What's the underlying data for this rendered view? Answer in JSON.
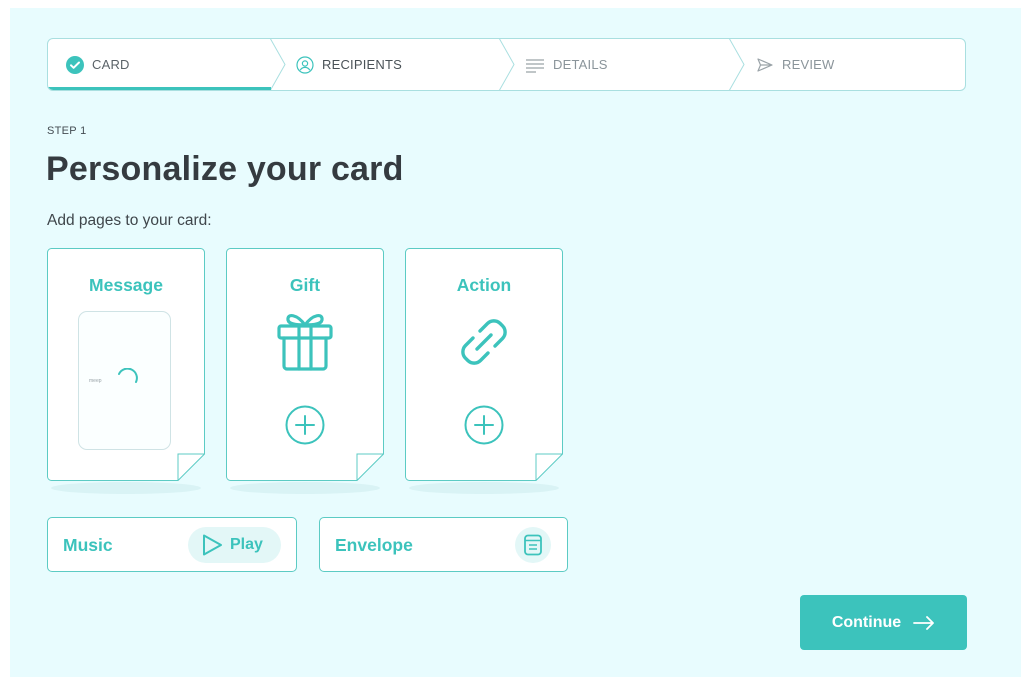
{
  "stepper": {
    "steps": [
      {
        "label": "CARD",
        "icon": "check-circle-icon",
        "state": "active"
      },
      {
        "label": "RECIPIENTS",
        "icon": "user-circle-icon",
        "state": "upcoming"
      },
      {
        "label": "DETAILS",
        "icon": "lines-icon",
        "state": "upcoming"
      },
      {
        "label": "REVIEW",
        "icon": "send-icon",
        "state": "upcoming"
      }
    ]
  },
  "step_eyebrow": "STEP 1",
  "title": "Personalize your card",
  "subtitle": "Add pages to your card:",
  "pages": [
    {
      "label": "Message",
      "preview_text": "meep",
      "icon": "loading-spinner-icon"
    },
    {
      "label": "Gift",
      "icon": "gift-icon"
    },
    {
      "label": "Action",
      "icon": "link-icon"
    }
  ],
  "options": {
    "music": {
      "label": "Music",
      "play_label": "Play"
    },
    "envelope": {
      "label": "Envelope",
      "icon": "envelope-icon"
    }
  },
  "continue_label": "Continue",
  "colors": {
    "accent": "#3cc3bc",
    "background": "#e8fcfe",
    "border": "#a9dfe0"
  }
}
